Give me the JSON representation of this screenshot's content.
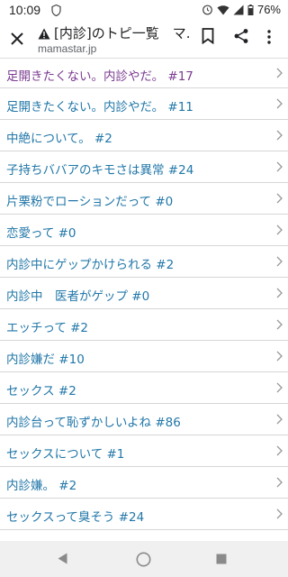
{
  "status_bar": {
    "time": "10:09",
    "battery_percent": "76%"
  },
  "toolbar": {
    "title": "[内診]のトピ一覧　マ...",
    "url": "mamastar.jp"
  },
  "topics": [
    {
      "label": "足開きたくない。内診やだ。 #17",
      "visited": true
    },
    {
      "label": "足開きたくない。内診やだ。 #11",
      "visited": false
    },
    {
      "label": "中絶について。 #2",
      "visited": false
    },
    {
      "label": "子持ちババアのキモさは異常 #24",
      "visited": false
    },
    {
      "label": "片栗粉でローションだって #0",
      "visited": false
    },
    {
      "label": "恋愛って #0",
      "visited": false
    },
    {
      "label": "内診中にゲップかけられる #2",
      "visited": false
    },
    {
      "label": "内診中　医者がゲップ #0",
      "visited": false
    },
    {
      "label": "エッチって #2",
      "visited": false
    },
    {
      "label": "内診嫌だ #10",
      "visited": false
    },
    {
      "label": "セックス #2",
      "visited": false
    },
    {
      "label": "内診台って恥ずかしいよね #86",
      "visited": false
    },
    {
      "label": "セックスについて #1",
      "visited": false
    },
    {
      "label": "内診嫌。 #2",
      "visited": false
    },
    {
      "label": "セックスって臭そう #24",
      "visited": false
    }
  ],
  "colors": {
    "link": "#2277a8",
    "visited_link": "#7b3c91",
    "warning": "#202124"
  }
}
